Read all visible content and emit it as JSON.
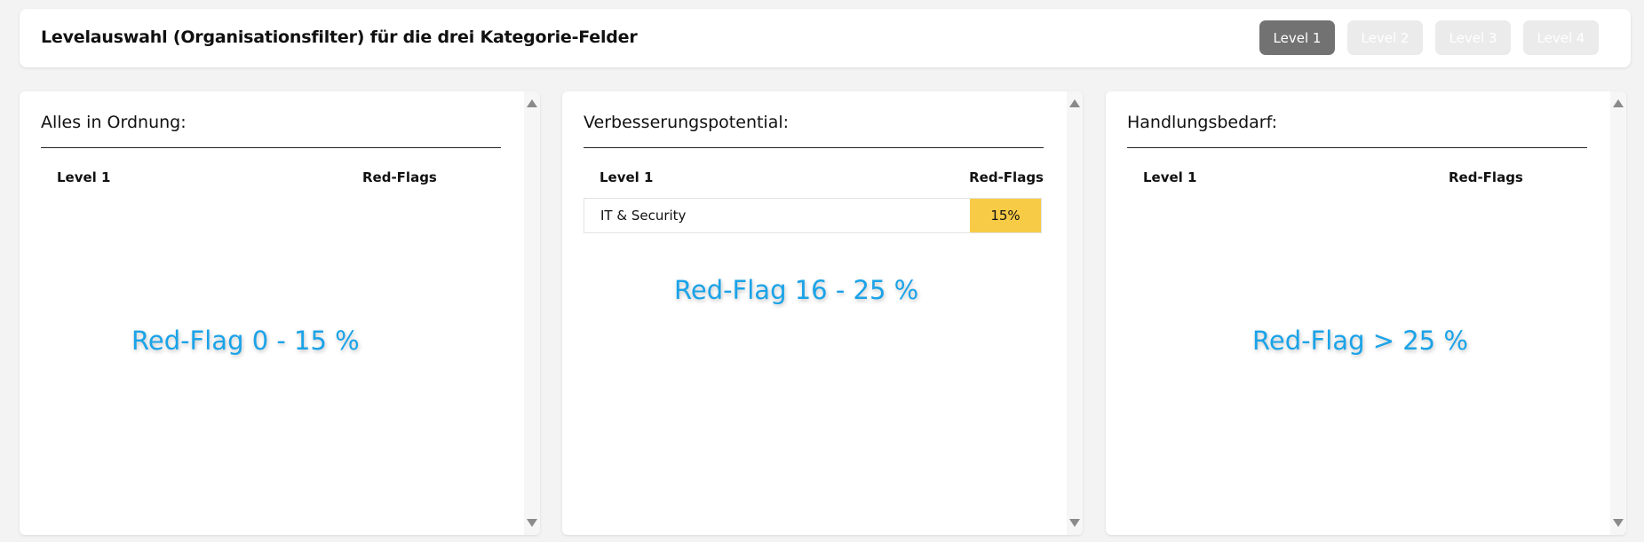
{
  "header": {
    "title": "Levelauswahl (Organisationsfilter) für die drei Kategorie-Felder",
    "levels": [
      {
        "label": "Level 1",
        "active": true
      },
      {
        "label": "Level 2",
        "active": false
      },
      {
        "label": "Level 3",
        "active": false
      },
      {
        "label": "Level 4",
        "active": false
      }
    ]
  },
  "panels": [
    {
      "title": "Alles in Ordnung:",
      "col_level": "Level 1",
      "col_flags": "Red-Flags",
      "rows": [],
      "range_note": "Red-Flag 0 - 15 %"
    },
    {
      "title": "Verbesserungspotential:",
      "col_level": "Level 1",
      "col_flags": "Red-Flags",
      "rows": [
        {
          "name": "IT & Security",
          "value": "15%",
          "color": "#f8cb46"
        }
      ],
      "range_note": "Red-Flag 16 - 25 %"
    },
    {
      "title": "Handlungsbedarf:",
      "col_level": "Level 1",
      "col_flags": "Red-Flags",
      "rows": [],
      "range_note": "Red-Flag > 25 %"
    }
  ],
  "colors": {
    "active_level": "#727272",
    "inactive_level": "#ebebeb",
    "annotation": "#1aa3e8",
    "warning_cell": "#f8cb46"
  },
  "icons": {
    "scroll_up": "triangle-up-icon",
    "scroll_down": "triangle-down-icon"
  }
}
